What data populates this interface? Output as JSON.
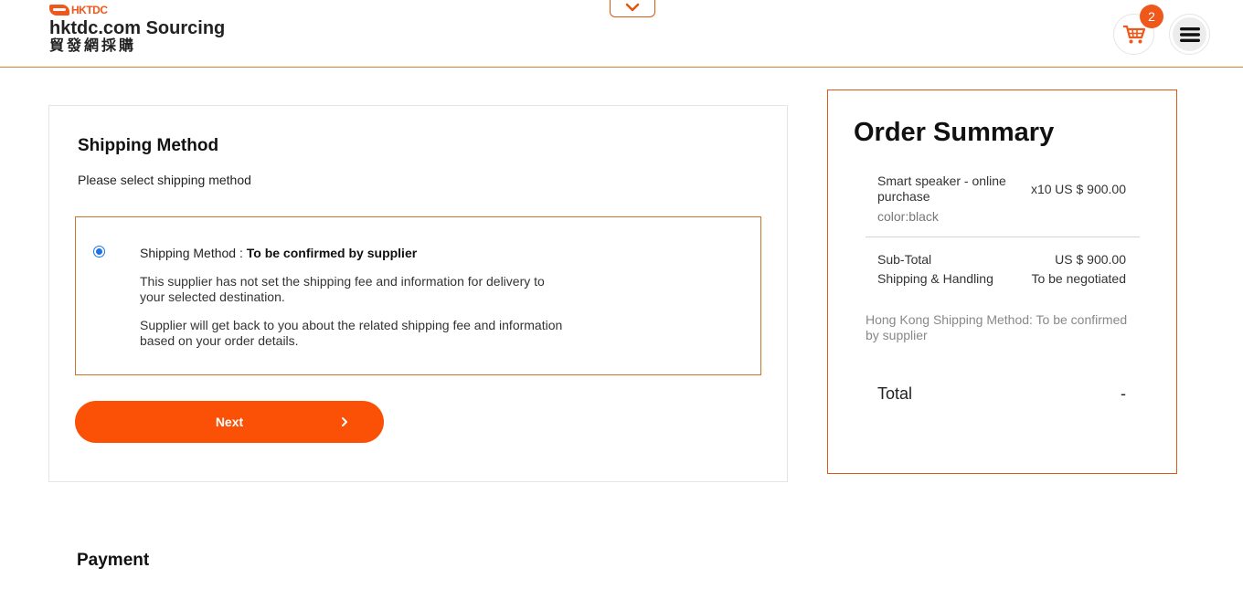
{
  "header": {
    "brand_short": "HKTDC",
    "title": "hktdc.com Sourcing",
    "title_chinese": "貿發網採購",
    "cart_count": "2",
    "icons": {
      "cart": "shopping-cart-icon",
      "menu": "hamburger-menu-icon",
      "collapse": "chevron-down-icon"
    }
  },
  "shipping": {
    "title": "Shipping Method",
    "subtitle": "Please select shipping method",
    "option": {
      "label": "Shipping Method : ",
      "value": "To be confirmed by supplier",
      "selected": true,
      "note1": "This supplier has not set the shipping fee and information for delivery to your selected destination.",
      "note2": "Supplier will get back to you about the related shipping fee and information based on your order details."
    },
    "next_label": "Next"
  },
  "summary": {
    "title": "Order Summary",
    "item": {
      "name": "Smart speaker - online purchase",
      "color": "color:black",
      "qty": "x10",
      "price": "US $ 900.00"
    },
    "subtotal_label": "Sub-Total",
    "subtotal_value": "US $ 900.00",
    "shipping_label": "Shipping & Handling",
    "shipping_value": "To be negotiated",
    "shipping_note": "Hong Kong  Shipping Method: To be confirmed by supplier",
    "total_label": "Total",
    "total_value": "-"
  },
  "payment": {
    "title": "Payment"
  },
  "colors": {
    "accent": "#fb5107",
    "border": "#c8752e",
    "radio": "#1a73e8"
  }
}
